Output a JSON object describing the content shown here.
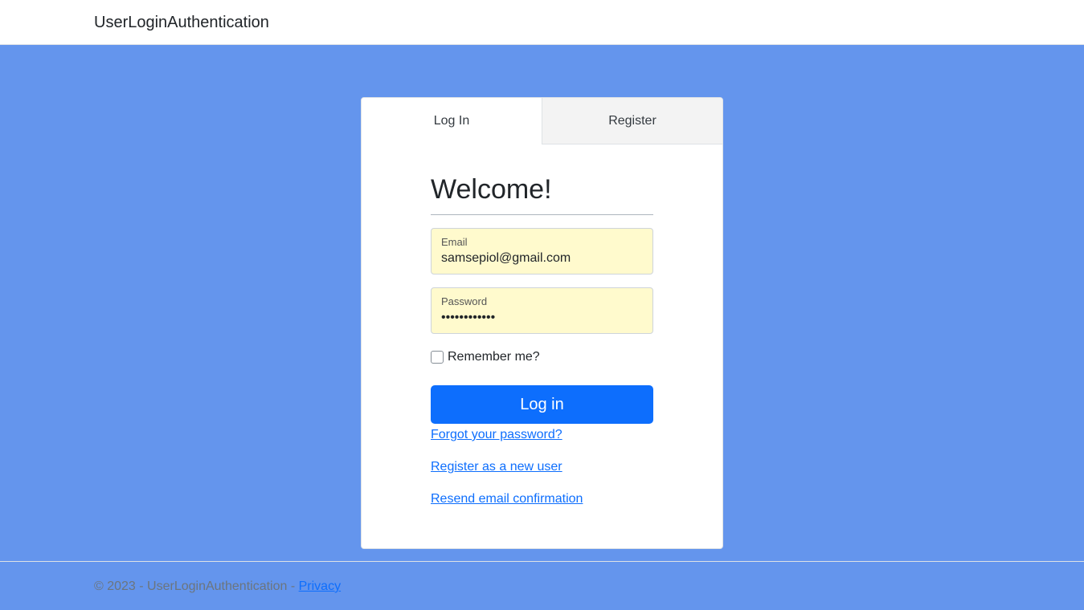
{
  "navbar": {
    "brand": "UserLoginAuthentication"
  },
  "tabs": [
    {
      "label": "Log In",
      "active": true
    },
    {
      "label": "Register",
      "active": false
    }
  ],
  "form": {
    "heading": "Welcome!",
    "email": {
      "label": "Email",
      "value": "samsepiol@gmail.com"
    },
    "password": {
      "label": "Password",
      "value": "••••••••••••"
    },
    "remember_label": "Remember me?",
    "remember_checked": false,
    "submit_label": "Log in",
    "links": {
      "forgot": "Forgot your password?",
      "register": "Register as a new user",
      "resend": "Resend email confirmation"
    }
  },
  "footer": {
    "text": "© 2023 - UserLoginAuthentication - ",
    "privacy_link": "Privacy"
  },
  "colors": {
    "background": "#6495ed",
    "primary": "#0d6efd",
    "autofill": "#fffacd"
  }
}
